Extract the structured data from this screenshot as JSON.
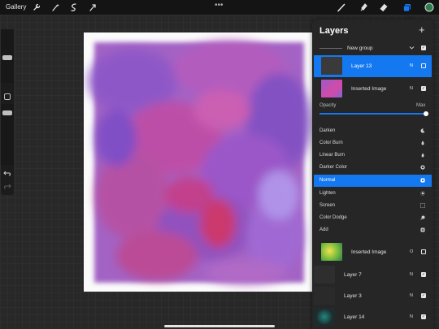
{
  "topbar": {
    "gallery_label": "Gallery",
    "more": "•••",
    "tools": [
      "wrench-icon",
      "magic-wand-icon",
      "selection-icon",
      "transform-icon"
    ],
    "brush_tools": [
      "brush-icon",
      "smudge-icon",
      "eraser-icon",
      "layers-icon",
      "color-swatch"
    ],
    "accent": "#1478f0",
    "active_color": "#2e7d4f"
  },
  "layers_panel": {
    "title": "Layers",
    "add_icon": "+",
    "group": {
      "label": "New group",
      "checked": true
    },
    "selected_layer": {
      "label": "Layer 13",
      "mode": "N",
      "checked": false
    },
    "layer_inserted_top": {
      "label": "Inserted Image",
      "mode": "N",
      "checked": true
    },
    "opacity": {
      "label": "Opacity",
      "max_label": "Max",
      "value_percent": 100
    },
    "blend_modes": [
      {
        "label": "Darken",
        "icon": "moon-icon"
      },
      {
        "label": "Color Burn",
        "icon": "color-burn-icon"
      },
      {
        "label": "Linear Burn",
        "icon": "flame-icon"
      },
      {
        "label": "Darker Color",
        "icon": "darker-color-icon"
      },
      {
        "label": "Normal",
        "icon": "normal-icon",
        "selected": true
      },
      {
        "label": "Lighten",
        "icon": "sun-icon"
      },
      {
        "label": "Screen",
        "icon": "screen-icon"
      },
      {
        "label": "Color Dodge",
        "icon": "color-dodge-icon"
      },
      {
        "label": "Add",
        "icon": "add-icon"
      }
    ],
    "lower_layers": [
      {
        "label": "Inserted Image",
        "mode": "O",
        "checked": false
      },
      {
        "label": "Layer 7",
        "mode": "N",
        "checked": true
      },
      {
        "label": "Layer 3",
        "mode": "N",
        "checked": true
      },
      {
        "label": "Layer 14",
        "mode": "N",
        "checked": true
      }
    ]
  },
  "sidebar": {
    "undo_icon": "undo-icon",
    "redo_icon": "redo-icon"
  }
}
